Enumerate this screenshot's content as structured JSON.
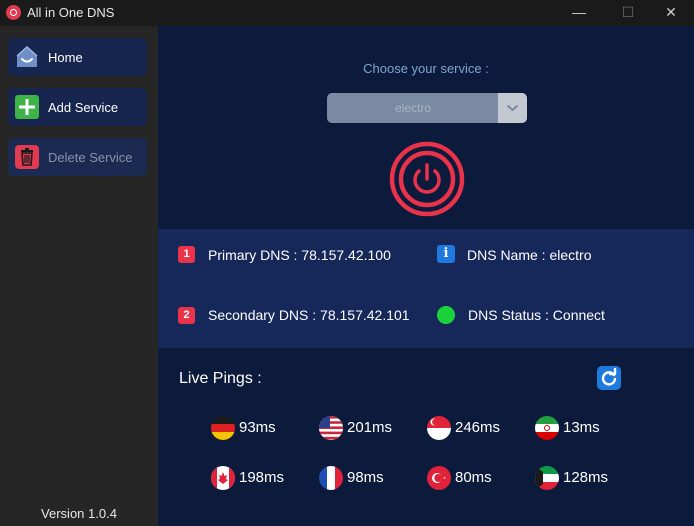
{
  "window": {
    "title": "All in One DNS",
    "minimize": "—",
    "maximize": "☐",
    "close": "✕"
  },
  "sidebar": {
    "items": [
      {
        "label": "Home",
        "icon": "home-icon",
        "enabled": true
      },
      {
        "label": "Add Service",
        "icon": "plus-icon",
        "enabled": true
      },
      {
        "label": "Delete Service",
        "icon": "trash-icon",
        "enabled": false
      }
    ],
    "version": "Version 1.0.4"
  },
  "main": {
    "choose_label": "Choose your service :",
    "service_select": {
      "value": "electro",
      "icon": "chevron-down-icon"
    },
    "power_button": {
      "icon": "power-icon",
      "color": "#e8334a"
    },
    "dns_info": {
      "primary_badge": "1",
      "primary": "Primary DNS : 78.157.42.100",
      "secondary_badge": "2",
      "secondary": "Secondary DNS : 78.157.42.101",
      "name_badge": "i",
      "name": "DNS Name : electro",
      "status": "DNS Status : Connect",
      "status_color": "#19d23a"
    },
    "pings": {
      "title": "Live Pings :",
      "refresh_icon": "refresh-icon",
      "items": [
        {
          "country": "germany",
          "value": "93ms"
        },
        {
          "country": "usa",
          "value": "201ms"
        },
        {
          "country": "singapore",
          "value": "246ms"
        },
        {
          "country": "iran",
          "value": "13ms"
        },
        {
          "country": "canada",
          "value": "198ms"
        },
        {
          "country": "france",
          "value": "98ms"
        },
        {
          "country": "turkey",
          "value": "80ms"
        },
        {
          "country": "kuwait",
          "value": "128ms"
        }
      ]
    }
  },
  "colors": {
    "accent_red": "#e8334a",
    "accent_blue": "#1f7ae0",
    "sidebar_bg": "#262626",
    "main_bg": "#0c1a3c",
    "panel_bg": "#16285a"
  }
}
